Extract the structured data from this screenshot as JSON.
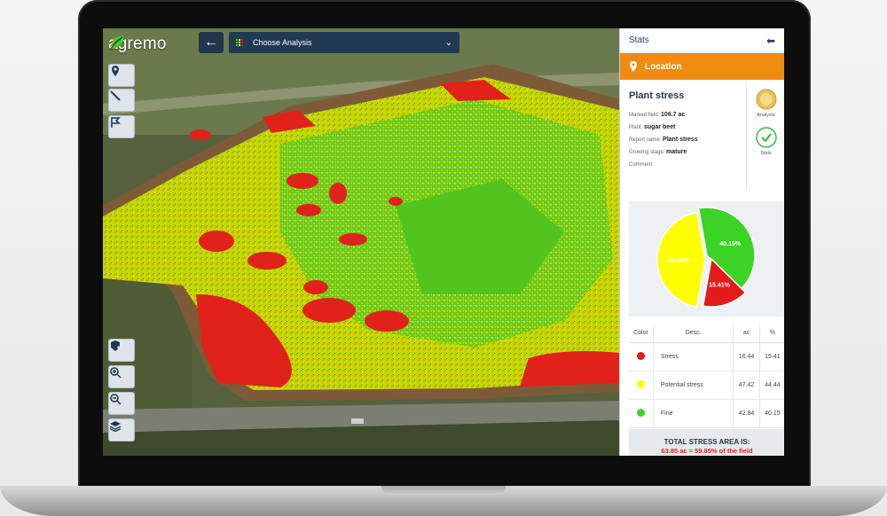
{
  "app": {
    "logo_text": "agremo",
    "back_label": "←",
    "analysis_label": "Choose Analysis"
  },
  "panel": {
    "title": "Stats",
    "collapse_label": "⬅",
    "location_label": "Location",
    "report_title": "Plant stress",
    "fields": [
      {
        "label": "Marked field:",
        "value": "106.7 ac"
      },
      {
        "label": "Plant:",
        "value": "sugar beet"
      },
      {
        "label": "Report name:",
        "value": "Plant stress"
      },
      {
        "label": "Growing stage:",
        "value": "mature"
      },
      {
        "label": "Comment:",
        "value": ""
      }
    ],
    "side_buttons": [
      {
        "label": "Analysis",
        "icon": "analysis-badge-icon"
      },
      {
        "label": "Stats",
        "icon": "check-circle-icon"
      }
    ],
    "table": {
      "headers": [
        "Color",
        "Desc.",
        "ac",
        "%"
      ],
      "rows": [
        {
          "color": "#e31b1b",
          "desc": "Stress",
          "ac": "16.44",
          "pct": "15.41"
        },
        {
          "color": "#ffff00",
          "desc": "Potential stress",
          "ac": "47.42",
          "pct": "44.44"
        },
        {
          "color": "#3bd324",
          "desc": "Fine",
          "ac": "42.84",
          "pct": "40.15"
        }
      ]
    },
    "total_title": "TOTAL STRESS AREA IS:",
    "total_value": "63.85 ac = 59.85% of the field"
  },
  "tools": [
    {
      "icon": "location-pin-icon"
    },
    {
      "icon": "draw-line-icon"
    },
    {
      "icon": "flag-polygon-icon"
    },
    {
      "icon": "add-layer-icon"
    },
    {
      "icon": "zoom-in-icon"
    },
    {
      "icon": "zoom-out-icon"
    },
    {
      "icon": "layers-icon"
    }
  ],
  "colors": {
    "stress": "#e31b1b",
    "potential": "#ffff00",
    "fine": "#3bd324",
    "accent": "#f08b12",
    "navy": "#1f3a52"
  },
  "chart_data": {
    "type": "pie",
    "labels": [
      "Fine",
      "Stress",
      "Potential stress"
    ],
    "values": [
      40.15,
      15.41,
      44.44
    ],
    "value_labels": [
      "40.15%",
      "15.41%",
      "44.44%"
    ],
    "colors": [
      "#3bd324",
      "#e31b1b",
      "#ffff00"
    ]
  }
}
